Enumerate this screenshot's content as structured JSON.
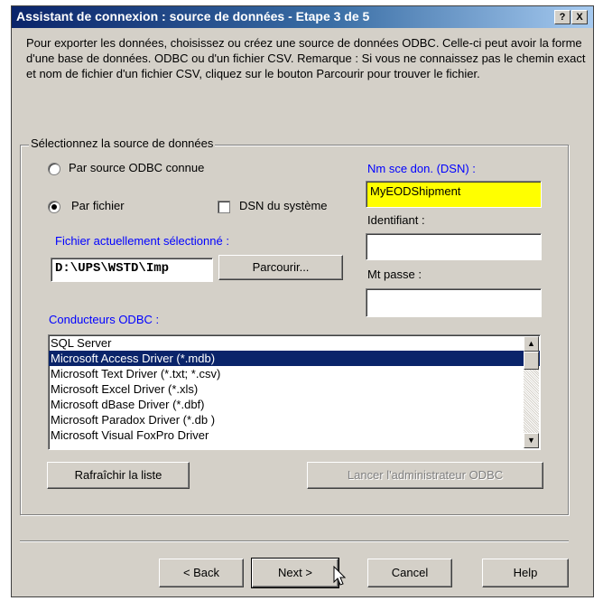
{
  "window": {
    "title": "Assistant de connexion : source de données - Etape 3 de 5",
    "help_btn": "?",
    "close_btn": "X"
  },
  "description": "Pour exporter les données, choisissez ou créez une source de données ODBC. Celle-ci peut avoir la forme d'une base de données. ODBC ou d'un fichier CSV.  Remarque : Si vous ne connaissez pas le chemin exact et nom de fichier d'un fichier CSV, cliquez sur le bouton Parcourir pour trouver le fichier.",
  "group": {
    "label": "Sélectionnez la source de données",
    "radio_odbc": "Par source ODBC connue",
    "radio_file": "Par fichier",
    "selected_radio": "file",
    "checkbox_system_dsn": "DSN du système",
    "checkbox_system_dsn_checked": false,
    "current_file_label": "Fichier actuellement sélectionné :",
    "current_file_value": "D:\\UPS\\WSTD\\Imp",
    "browse_button": "Parcourir...",
    "dsn_label": "Nm sce don. (DSN) :",
    "dsn_value": "MyEODShipment",
    "dsn_highlight_color": "#ffff00",
    "user_label": "Identifiant :",
    "user_value": "",
    "password_label": "Mt passe :",
    "password_value": "",
    "drivers_label": "Conducteurs ODBC :",
    "drivers": [
      "SQL Server",
      "Microsoft Access Driver (*.mdb)",
      "Microsoft Text Driver (*.txt; *.csv)",
      "Microsoft Excel Driver (*.xls)",
      "Microsoft dBase Driver (*.dbf)",
      "Microsoft Paradox Driver (*.db )",
      "Microsoft Visual FoxPro Driver"
    ],
    "selected_driver": "Microsoft Access Driver (*.mdb)",
    "refresh_button": "Rafraîchir la liste",
    "odbc_admin_button": "Lancer l'administrateur ODBC"
  },
  "footer": {
    "back_button": "< Back",
    "next_button": "Next >",
    "cancel_button": "Cancel",
    "help_button": "Help"
  },
  "colors": {
    "title_bar_start": "#0a246a",
    "dialog_face": "#d4d0c8",
    "label_blue": "#0000ff",
    "selection": "#0a246a"
  }
}
